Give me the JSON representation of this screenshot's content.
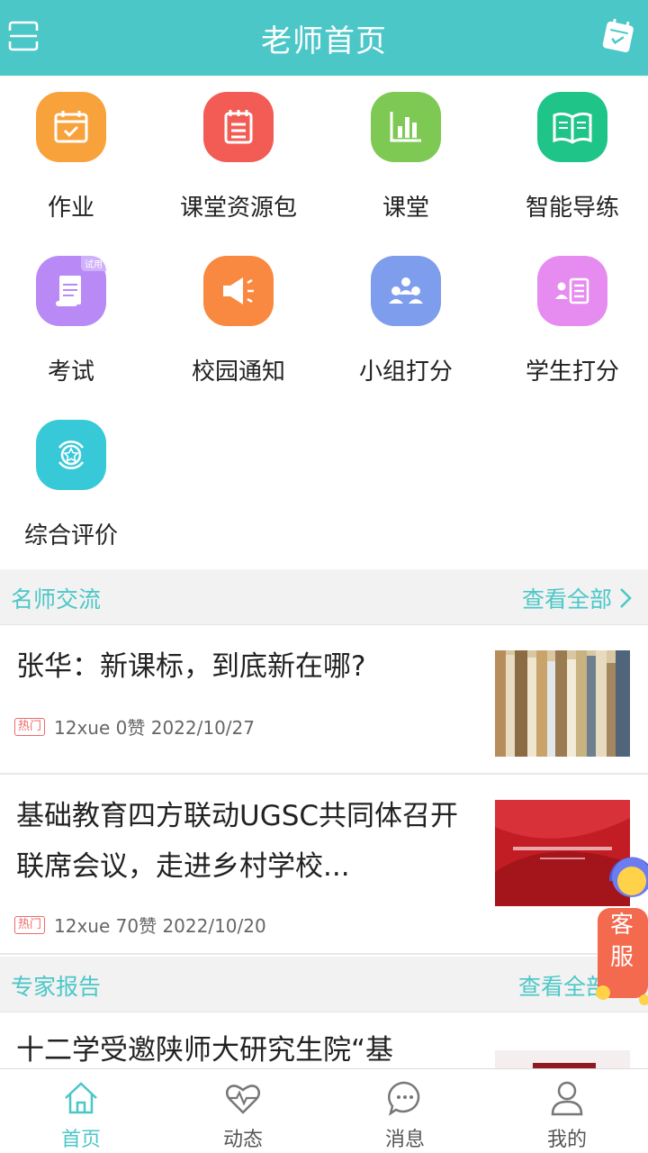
{
  "header": {
    "title": "老师首页",
    "left_icon": "scan-icon",
    "right_icon": "calendar-icon"
  },
  "grid": [
    {
      "label": "作业",
      "icon": "homework-icon",
      "color": "#f8a23c"
    },
    {
      "label": "课堂资源包",
      "icon": "resource-pack-icon",
      "color": "#f25c54"
    },
    {
      "label": "课堂",
      "icon": "classroom-chart-icon",
      "color": "#7dc954"
    },
    {
      "label": "智能导练",
      "icon": "book-icon",
      "color": "#1ec488"
    },
    {
      "label": "考试",
      "icon": "exam-icon",
      "color": "#b98af5",
      "badge": "试用"
    },
    {
      "label": "校园通知",
      "icon": "megaphone-icon",
      "color": "#f98840"
    },
    {
      "label": "小组打分",
      "icon": "group-icon",
      "color": "#7f9ded"
    },
    {
      "label": "学生打分",
      "icon": "student-list-icon",
      "color": "#e68bf0"
    },
    {
      "label": "综合评价",
      "icon": "star-evaluation-icon",
      "color": "#38c9d8"
    }
  ],
  "sections": {
    "teachers": {
      "title": "名师交流",
      "more": "查看全部"
    },
    "experts": {
      "title": "专家报告",
      "more": "查看全部"
    }
  },
  "articles": [
    {
      "title": "张华：新课标，到底新在哪?",
      "tag": "热门",
      "meta": "12xue 0赞 2022/10/27"
    },
    {
      "title": "基础教育四方联动UGSC共同体召开联席会议，走进乡村学校...",
      "tag": "热门",
      "meta": "12xue 70赞 2022/10/20"
    },
    {
      "title": "十二学受邀陕师大研究生院“基"
    }
  ],
  "fab": {
    "label_top": "客",
    "label_bottom": "服"
  },
  "nav": [
    {
      "label": "首页",
      "icon": "home-icon",
      "active": true
    },
    {
      "label": "动态",
      "icon": "activity-heart-icon",
      "active": false
    },
    {
      "label": "消息",
      "icon": "message-icon",
      "active": false
    },
    {
      "label": "我的",
      "icon": "profile-icon",
      "active": false
    }
  ],
  "colors": {
    "accent": "#4cc7c8",
    "hot": "#ee6a6a"
  }
}
